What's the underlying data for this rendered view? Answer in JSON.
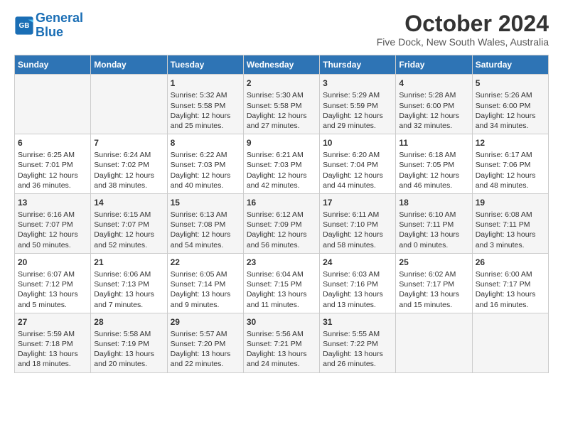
{
  "logo": {
    "line1": "General",
    "line2": "Blue"
  },
  "title": "October 2024",
  "subtitle": "Five Dock, New South Wales, Australia",
  "days_of_week": [
    "Sunday",
    "Monday",
    "Tuesday",
    "Wednesday",
    "Thursday",
    "Friday",
    "Saturday"
  ],
  "weeks": [
    [
      {
        "day": "",
        "info": ""
      },
      {
        "day": "",
        "info": ""
      },
      {
        "day": "1",
        "info": "Sunrise: 5:32 AM\nSunset: 5:58 PM\nDaylight: 12 hours\nand 25 minutes."
      },
      {
        "day": "2",
        "info": "Sunrise: 5:30 AM\nSunset: 5:58 PM\nDaylight: 12 hours\nand 27 minutes."
      },
      {
        "day": "3",
        "info": "Sunrise: 5:29 AM\nSunset: 5:59 PM\nDaylight: 12 hours\nand 29 minutes."
      },
      {
        "day": "4",
        "info": "Sunrise: 5:28 AM\nSunset: 6:00 PM\nDaylight: 12 hours\nand 32 minutes."
      },
      {
        "day": "5",
        "info": "Sunrise: 5:26 AM\nSunset: 6:00 PM\nDaylight: 12 hours\nand 34 minutes."
      }
    ],
    [
      {
        "day": "6",
        "info": "Sunrise: 6:25 AM\nSunset: 7:01 PM\nDaylight: 12 hours\nand 36 minutes."
      },
      {
        "day": "7",
        "info": "Sunrise: 6:24 AM\nSunset: 7:02 PM\nDaylight: 12 hours\nand 38 minutes."
      },
      {
        "day": "8",
        "info": "Sunrise: 6:22 AM\nSunset: 7:03 PM\nDaylight: 12 hours\nand 40 minutes."
      },
      {
        "day": "9",
        "info": "Sunrise: 6:21 AM\nSunset: 7:03 PM\nDaylight: 12 hours\nand 42 minutes."
      },
      {
        "day": "10",
        "info": "Sunrise: 6:20 AM\nSunset: 7:04 PM\nDaylight: 12 hours\nand 44 minutes."
      },
      {
        "day": "11",
        "info": "Sunrise: 6:18 AM\nSunset: 7:05 PM\nDaylight: 12 hours\nand 46 minutes."
      },
      {
        "day": "12",
        "info": "Sunrise: 6:17 AM\nSunset: 7:06 PM\nDaylight: 12 hours\nand 48 minutes."
      }
    ],
    [
      {
        "day": "13",
        "info": "Sunrise: 6:16 AM\nSunset: 7:07 PM\nDaylight: 12 hours\nand 50 minutes."
      },
      {
        "day": "14",
        "info": "Sunrise: 6:15 AM\nSunset: 7:07 PM\nDaylight: 12 hours\nand 52 minutes."
      },
      {
        "day": "15",
        "info": "Sunrise: 6:13 AM\nSunset: 7:08 PM\nDaylight: 12 hours\nand 54 minutes."
      },
      {
        "day": "16",
        "info": "Sunrise: 6:12 AM\nSunset: 7:09 PM\nDaylight: 12 hours\nand 56 minutes."
      },
      {
        "day": "17",
        "info": "Sunrise: 6:11 AM\nSunset: 7:10 PM\nDaylight: 12 hours\nand 58 minutes."
      },
      {
        "day": "18",
        "info": "Sunrise: 6:10 AM\nSunset: 7:11 PM\nDaylight: 13 hours\nand 0 minutes."
      },
      {
        "day": "19",
        "info": "Sunrise: 6:08 AM\nSunset: 7:11 PM\nDaylight: 13 hours\nand 3 minutes."
      }
    ],
    [
      {
        "day": "20",
        "info": "Sunrise: 6:07 AM\nSunset: 7:12 PM\nDaylight: 13 hours\nand 5 minutes."
      },
      {
        "day": "21",
        "info": "Sunrise: 6:06 AM\nSunset: 7:13 PM\nDaylight: 13 hours\nand 7 minutes."
      },
      {
        "day": "22",
        "info": "Sunrise: 6:05 AM\nSunset: 7:14 PM\nDaylight: 13 hours\nand 9 minutes."
      },
      {
        "day": "23",
        "info": "Sunrise: 6:04 AM\nSunset: 7:15 PM\nDaylight: 13 hours\nand 11 minutes."
      },
      {
        "day": "24",
        "info": "Sunrise: 6:03 AM\nSunset: 7:16 PM\nDaylight: 13 hours\nand 13 minutes."
      },
      {
        "day": "25",
        "info": "Sunrise: 6:02 AM\nSunset: 7:17 PM\nDaylight: 13 hours\nand 15 minutes."
      },
      {
        "day": "26",
        "info": "Sunrise: 6:00 AM\nSunset: 7:17 PM\nDaylight: 13 hours\nand 16 minutes."
      }
    ],
    [
      {
        "day": "27",
        "info": "Sunrise: 5:59 AM\nSunset: 7:18 PM\nDaylight: 13 hours\nand 18 minutes."
      },
      {
        "day": "28",
        "info": "Sunrise: 5:58 AM\nSunset: 7:19 PM\nDaylight: 13 hours\nand 20 minutes."
      },
      {
        "day": "29",
        "info": "Sunrise: 5:57 AM\nSunset: 7:20 PM\nDaylight: 13 hours\nand 22 minutes."
      },
      {
        "day": "30",
        "info": "Sunrise: 5:56 AM\nSunset: 7:21 PM\nDaylight: 13 hours\nand 24 minutes."
      },
      {
        "day": "31",
        "info": "Sunrise: 5:55 AM\nSunset: 7:22 PM\nDaylight: 13 hours\nand 26 minutes."
      },
      {
        "day": "",
        "info": ""
      },
      {
        "day": "",
        "info": ""
      }
    ]
  ]
}
